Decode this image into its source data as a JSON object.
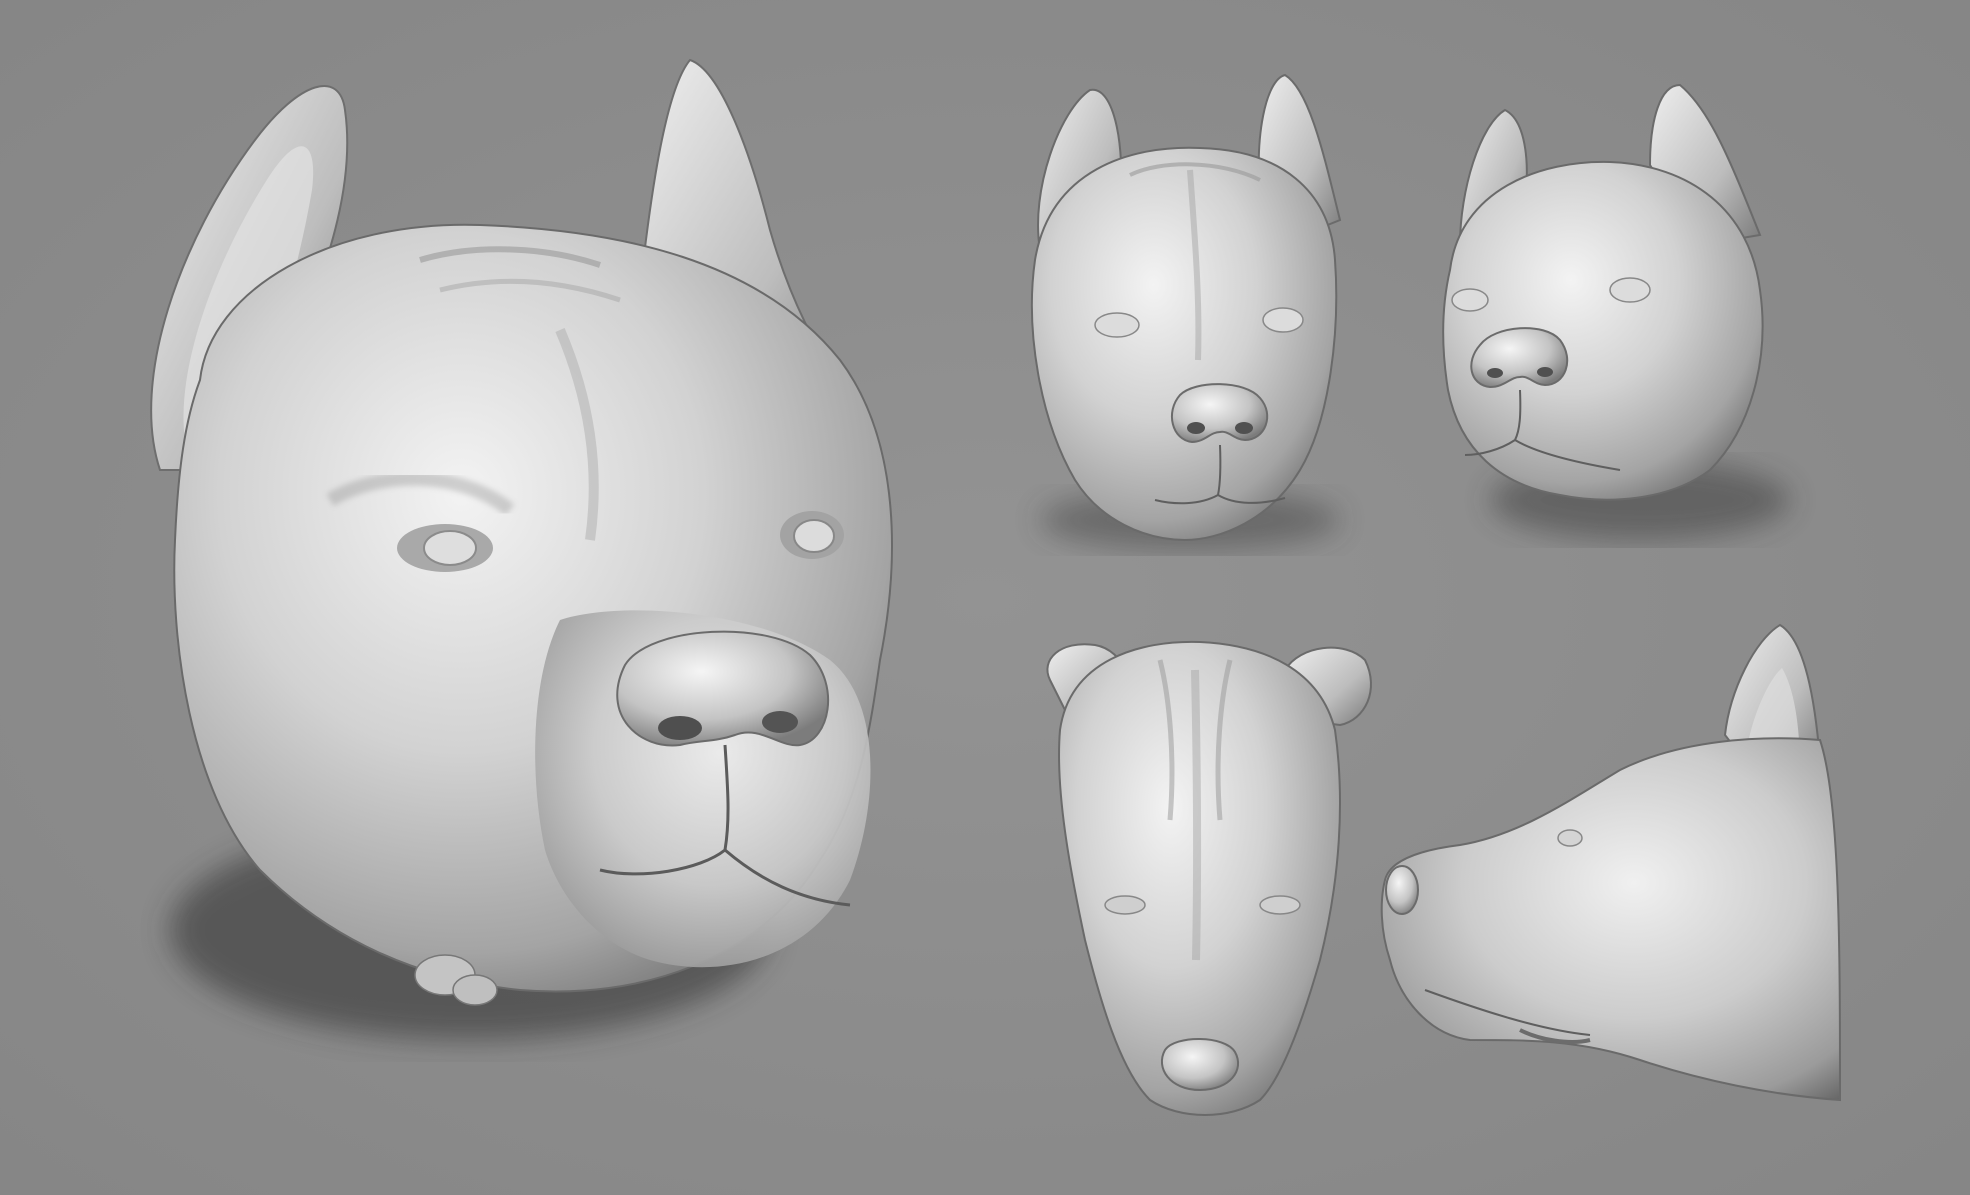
{
  "scene": {
    "background_color": "#8d8d8d",
    "material_color": "#c9c9c9",
    "material_highlight": "#f2f2f2",
    "material_shadow": "#555555",
    "cast_shadow_color": "#3a3a3a"
  },
  "views": [
    {
      "name": "three-quarter-large",
      "icon": "dog-head-three-quarter"
    },
    {
      "name": "front",
      "icon": "dog-head-front"
    },
    {
      "name": "three-quarter-small",
      "icon": "dog-head-three-quarter"
    },
    {
      "name": "top",
      "icon": "dog-head-top"
    },
    {
      "name": "side",
      "icon": "dog-head-side"
    }
  ]
}
